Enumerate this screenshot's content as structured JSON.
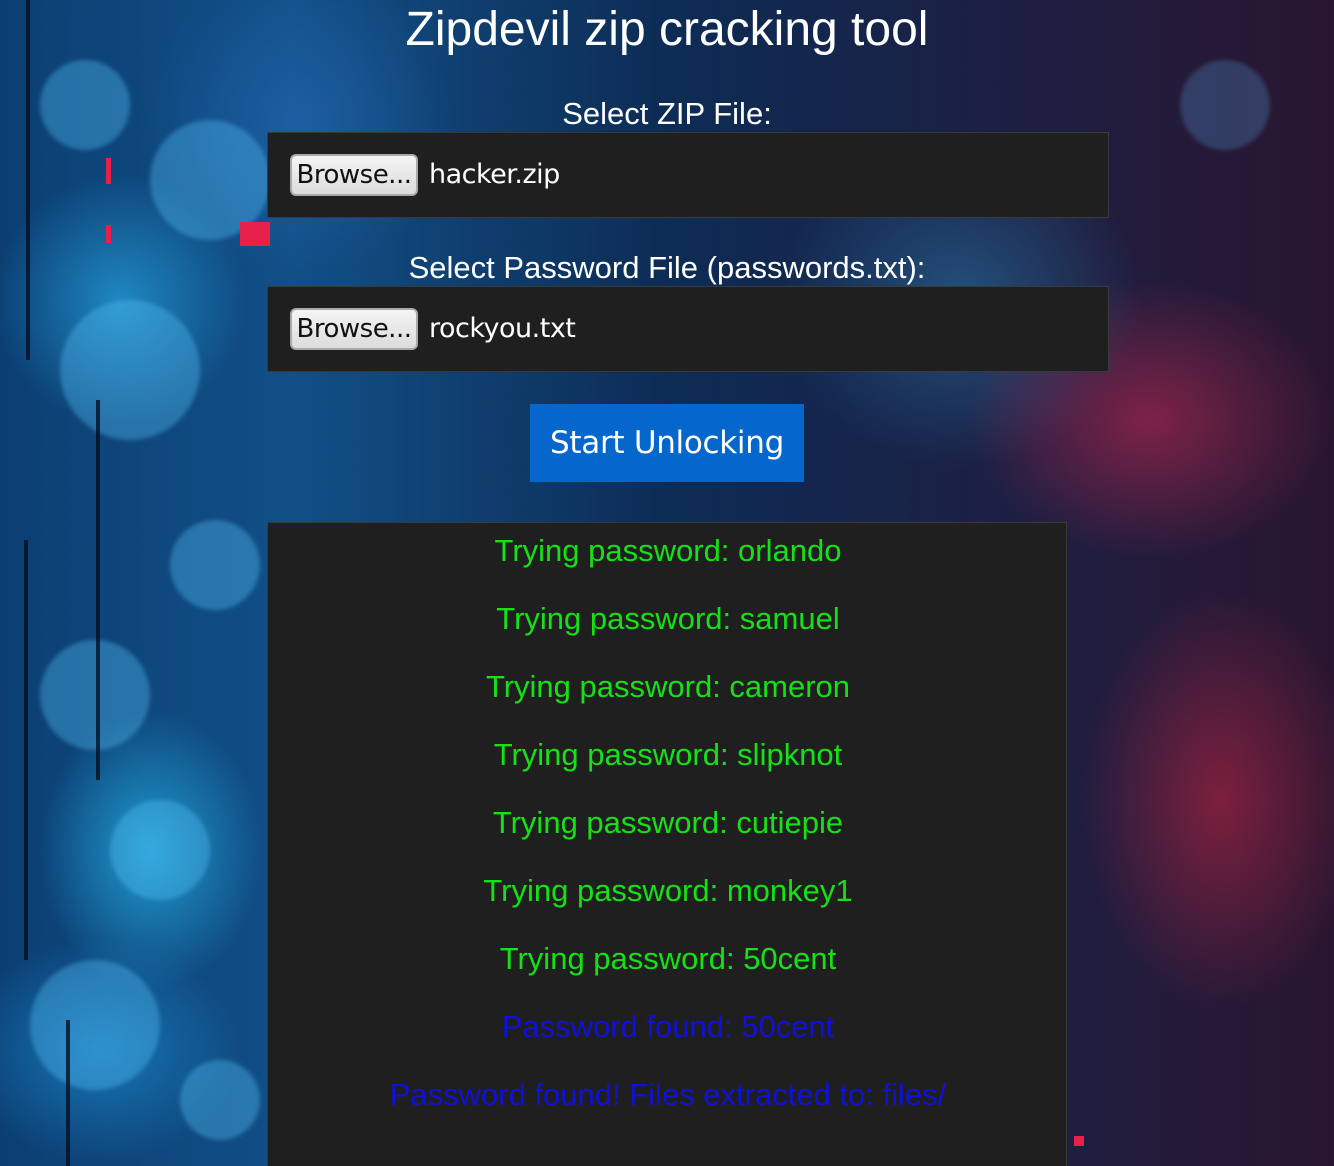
{
  "title": "Zipdevil zip cracking tool",
  "zip_section": {
    "label": "Select ZIP File:",
    "browse_label": "Browse...",
    "file_name": "hacker.zip"
  },
  "password_section": {
    "label": "Select Password File (passwords.txt):",
    "browse_label": "Browse...",
    "file_name": "rockyou.txt"
  },
  "start_button": "Start Unlocking",
  "log": {
    "lines": [
      "Trying password: orlando",
      "Trying password: samuel",
      "Trying password: cameron",
      "Trying password: slipknot",
      "Trying password: cutiepie",
      "Trying password: monkey1",
      "Trying password: 50cent",
      "Password found: 50cent",
      "Password found! Files extracted to: files/"
    ]
  },
  "colors": {
    "attempt_text": "#16e016",
    "found_text": "#1010d8",
    "button_accent": "#0566cc",
    "panel_bg": "#1f1f1f"
  }
}
